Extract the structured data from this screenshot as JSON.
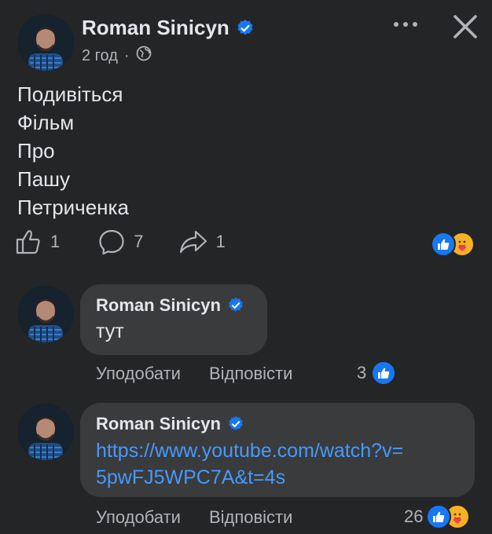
{
  "post": {
    "author": "Roman Sinicyn",
    "time": "2 год",
    "lines": [
      "Подивіться",
      "Фільм",
      "Про",
      "Пашу",
      "Петриченка"
    ],
    "like_count": "1",
    "comment_count": "7",
    "share_count": "1",
    "reactions": [
      "like",
      "care"
    ]
  },
  "comments": [
    {
      "author": "Roman Sinicyn",
      "text": "тут",
      "like_label": "Уподобати",
      "reply_label": "Відповісти",
      "reaction_count": "3",
      "reactions": [
        "like"
      ]
    },
    {
      "author": "Roman Sinicyn",
      "link_line1": "https://www.youtube.com/watch?v=",
      "link_line2": "5pwFJ5WPC7A&t=4s",
      "like_label": "Уподобати",
      "reply_label": "Відповісти",
      "reaction_count": "26",
      "reactions": [
        "like",
        "care"
      ]
    }
  ],
  "icons": {
    "verified": "verified-badge-icon",
    "audience": "globe-icon",
    "more": "more-dots-icon",
    "close": "close-icon",
    "like": "thumbs-up-icon",
    "comment": "comment-bubble-icon",
    "share": "share-arrow-icon"
  },
  "colors": {
    "background": "#242526",
    "bubble": "#3a3b3c",
    "verified": "#1877f2",
    "link": "#4599ff",
    "secondary_text": "#b0b3b8"
  }
}
